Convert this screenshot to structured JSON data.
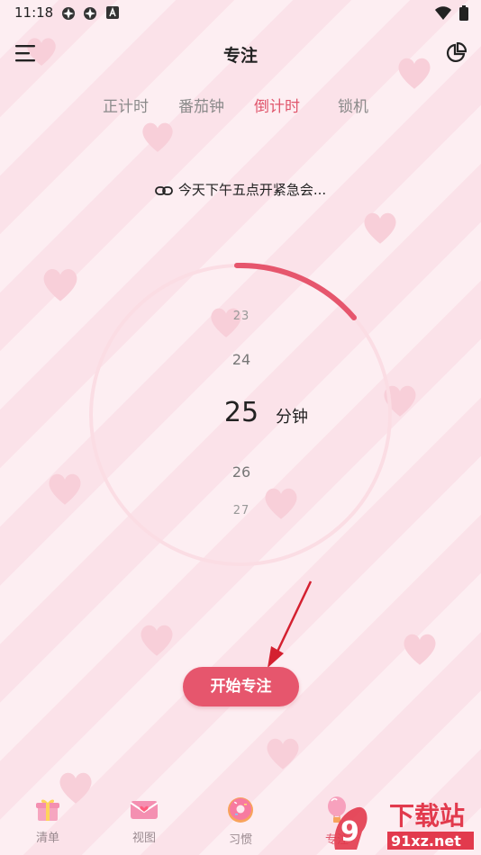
{
  "status_bar": {
    "time": "11:18"
  },
  "header": {
    "title": "专注"
  },
  "tabs": [
    {
      "label": "正计时",
      "active": false
    },
    {
      "label": "番茄钟",
      "active": false
    },
    {
      "label": "倒计时",
      "active": true
    },
    {
      "label": "锁机",
      "active": false
    }
  ],
  "task": {
    "text": "今天下午五点开紧急会..."
  },
  "picker": {
    "values": [
      "23",
      "24",
      "25",
      "26",
      "27"
    ],
    "selected": "25",
    "unit": "分钟"
  },
  "start_button": {
    "label": "开始专注"
  },
  "bottom_nav": [
    {
      "label": "清单",
      "icon": "gift-icon"
    },
    {
      "label": "视图",
      "icon": "envelope-icon"
    },
    {
      "label": "习惯",
      "icon": "donut-icon"
    },
    {
      "label": "专注",
      "icon": "balloon-icon",
      "active": true
    }
  ],
  "watermark": {
    "text1": "下载站",
    "text2": "91xz.net"
  },
  "colors": {
    "accent": "#e0566c",
    "button": "#e6566d",
    "ring": "#fbdde4"
  }
}
